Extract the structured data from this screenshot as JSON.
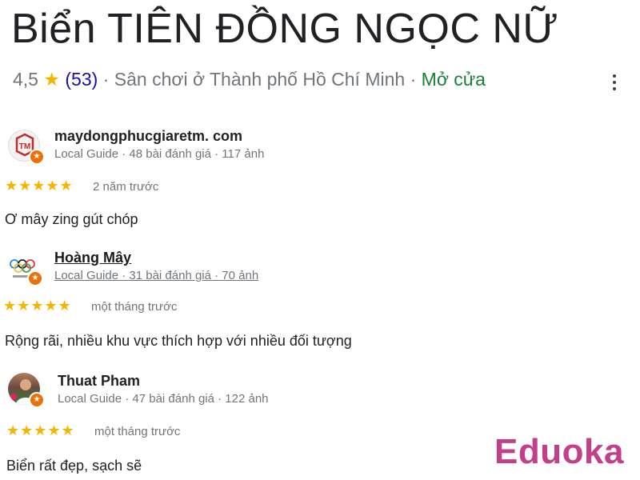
{
  "place": {
    "title": "Biển TIÊN ĐỒNG NGỌC NỮ",
    "rating": "4,5",
    "star": "★",
    "review_count": "(53)",
    "separator_1": " · ",
    "category": "Sân chơi ở Thành phố Hồ Chí Minh",
    "separator_2": " · ",
    "open_status": "Mở cửa",
    "more_icon": "more-vert-icon"
  },
  "reviews": [
    {
      "name": "maydongphucgiaretm. com",
      "meta": "Local Guide · 48 bài đánh giá · 117 ảnh",
      "stars": "★★★★★",
      "rating": 5,
      "time": "2 năm trước",
      "text": "Ơ mây zing gút chóp",
      "avatar_icon": "tm-logo-avatar",
      "badge_icon": "local-guide-star-icon"
    },
    {
      "name": "Hoàng Mây",
      "meta": "Local Guide · 31 bài đánh giá · 70 ảnh",
      "stars": "★★★★★",
      "rating": 5,
      "time": "một tháng trước",
      "text": "Rộng rãi, nhiều khu vực thích hợp với nhiều đối tượng",
      "avatar_icon": "olympic-rings-avatar",
      "badge_icon": "local-guide-star-icon"
    },
    {
      "name": "Thuat Pham",
      "meta": "Local Guide · 47 bài đánh giá · 122 ảnh",
      "stars": "★★★★★",
      "rating": 5,
      "time": "một tháng trước",
      "text": "Biển rất đẹp, sạch sẽ",
      "avatar_icon": "user-photo-avatar",
      "badge_icon": "local-guide-star-icon"
    }
  ],
  "watermark": {
    "text": "Eduoka"
  },
  "colors": {
    "star": "#f4b400",
    "link": "#1a0dab",
    "open": "#188038",
    "badge": "#e8710a",
    "watermark": "#c2408a"
  }
}
